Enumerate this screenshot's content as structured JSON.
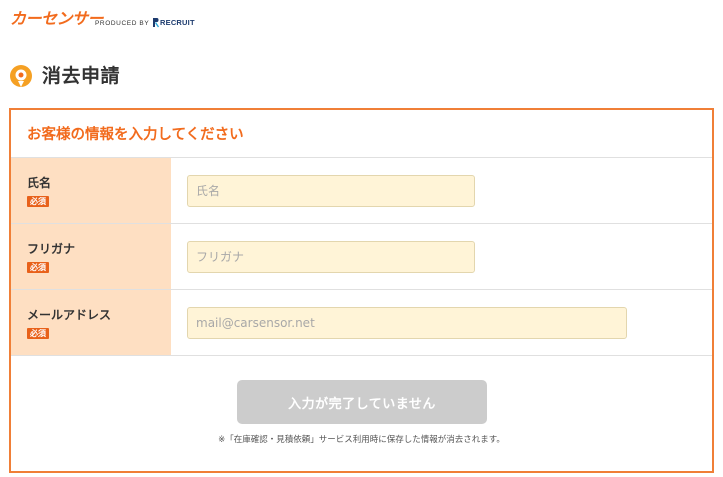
{
  "header": {
    "logo_text": "カーセンサー",
    "produced_by": "PRODUCED BY",
    "recruit_text": "RECRUIT"
  },
  "page": {
    "title": "消去申請",
    "title_icon": "location-pin-icon"
  },
  "form": {
    "heading": "お客様の情報を入力してください",
    "fields": [
      {
        "label": "氏名",
        "required_badge": "必須",
        "value": "",
        "placeholder": "氏名"
      },
      {
        "label": "フリガナ",
        "required_badge": "必須",
        "value": "",
        "placeholder": "フリガナ"
      },
      {
        "label": "メールアドレス",
        "required_badge": "必須",
        "value": "",
        "placeholder": "mail@carsensor.net"
      }
    ],
    "submit_label": "入力が完了していません",
    "note": "※「在庫確認・見積依頼」サービス利用時に保存した情報が消去されます。"
  },
  "colors": {
    "brand_orange": "#f26b1d",
    "label_background": "#fedfc2",
    "input_background": "#fff4d7",
    "disabled_button": "#cccccc",
    "recruit_blue": "#1d3b6e"
  }
}
